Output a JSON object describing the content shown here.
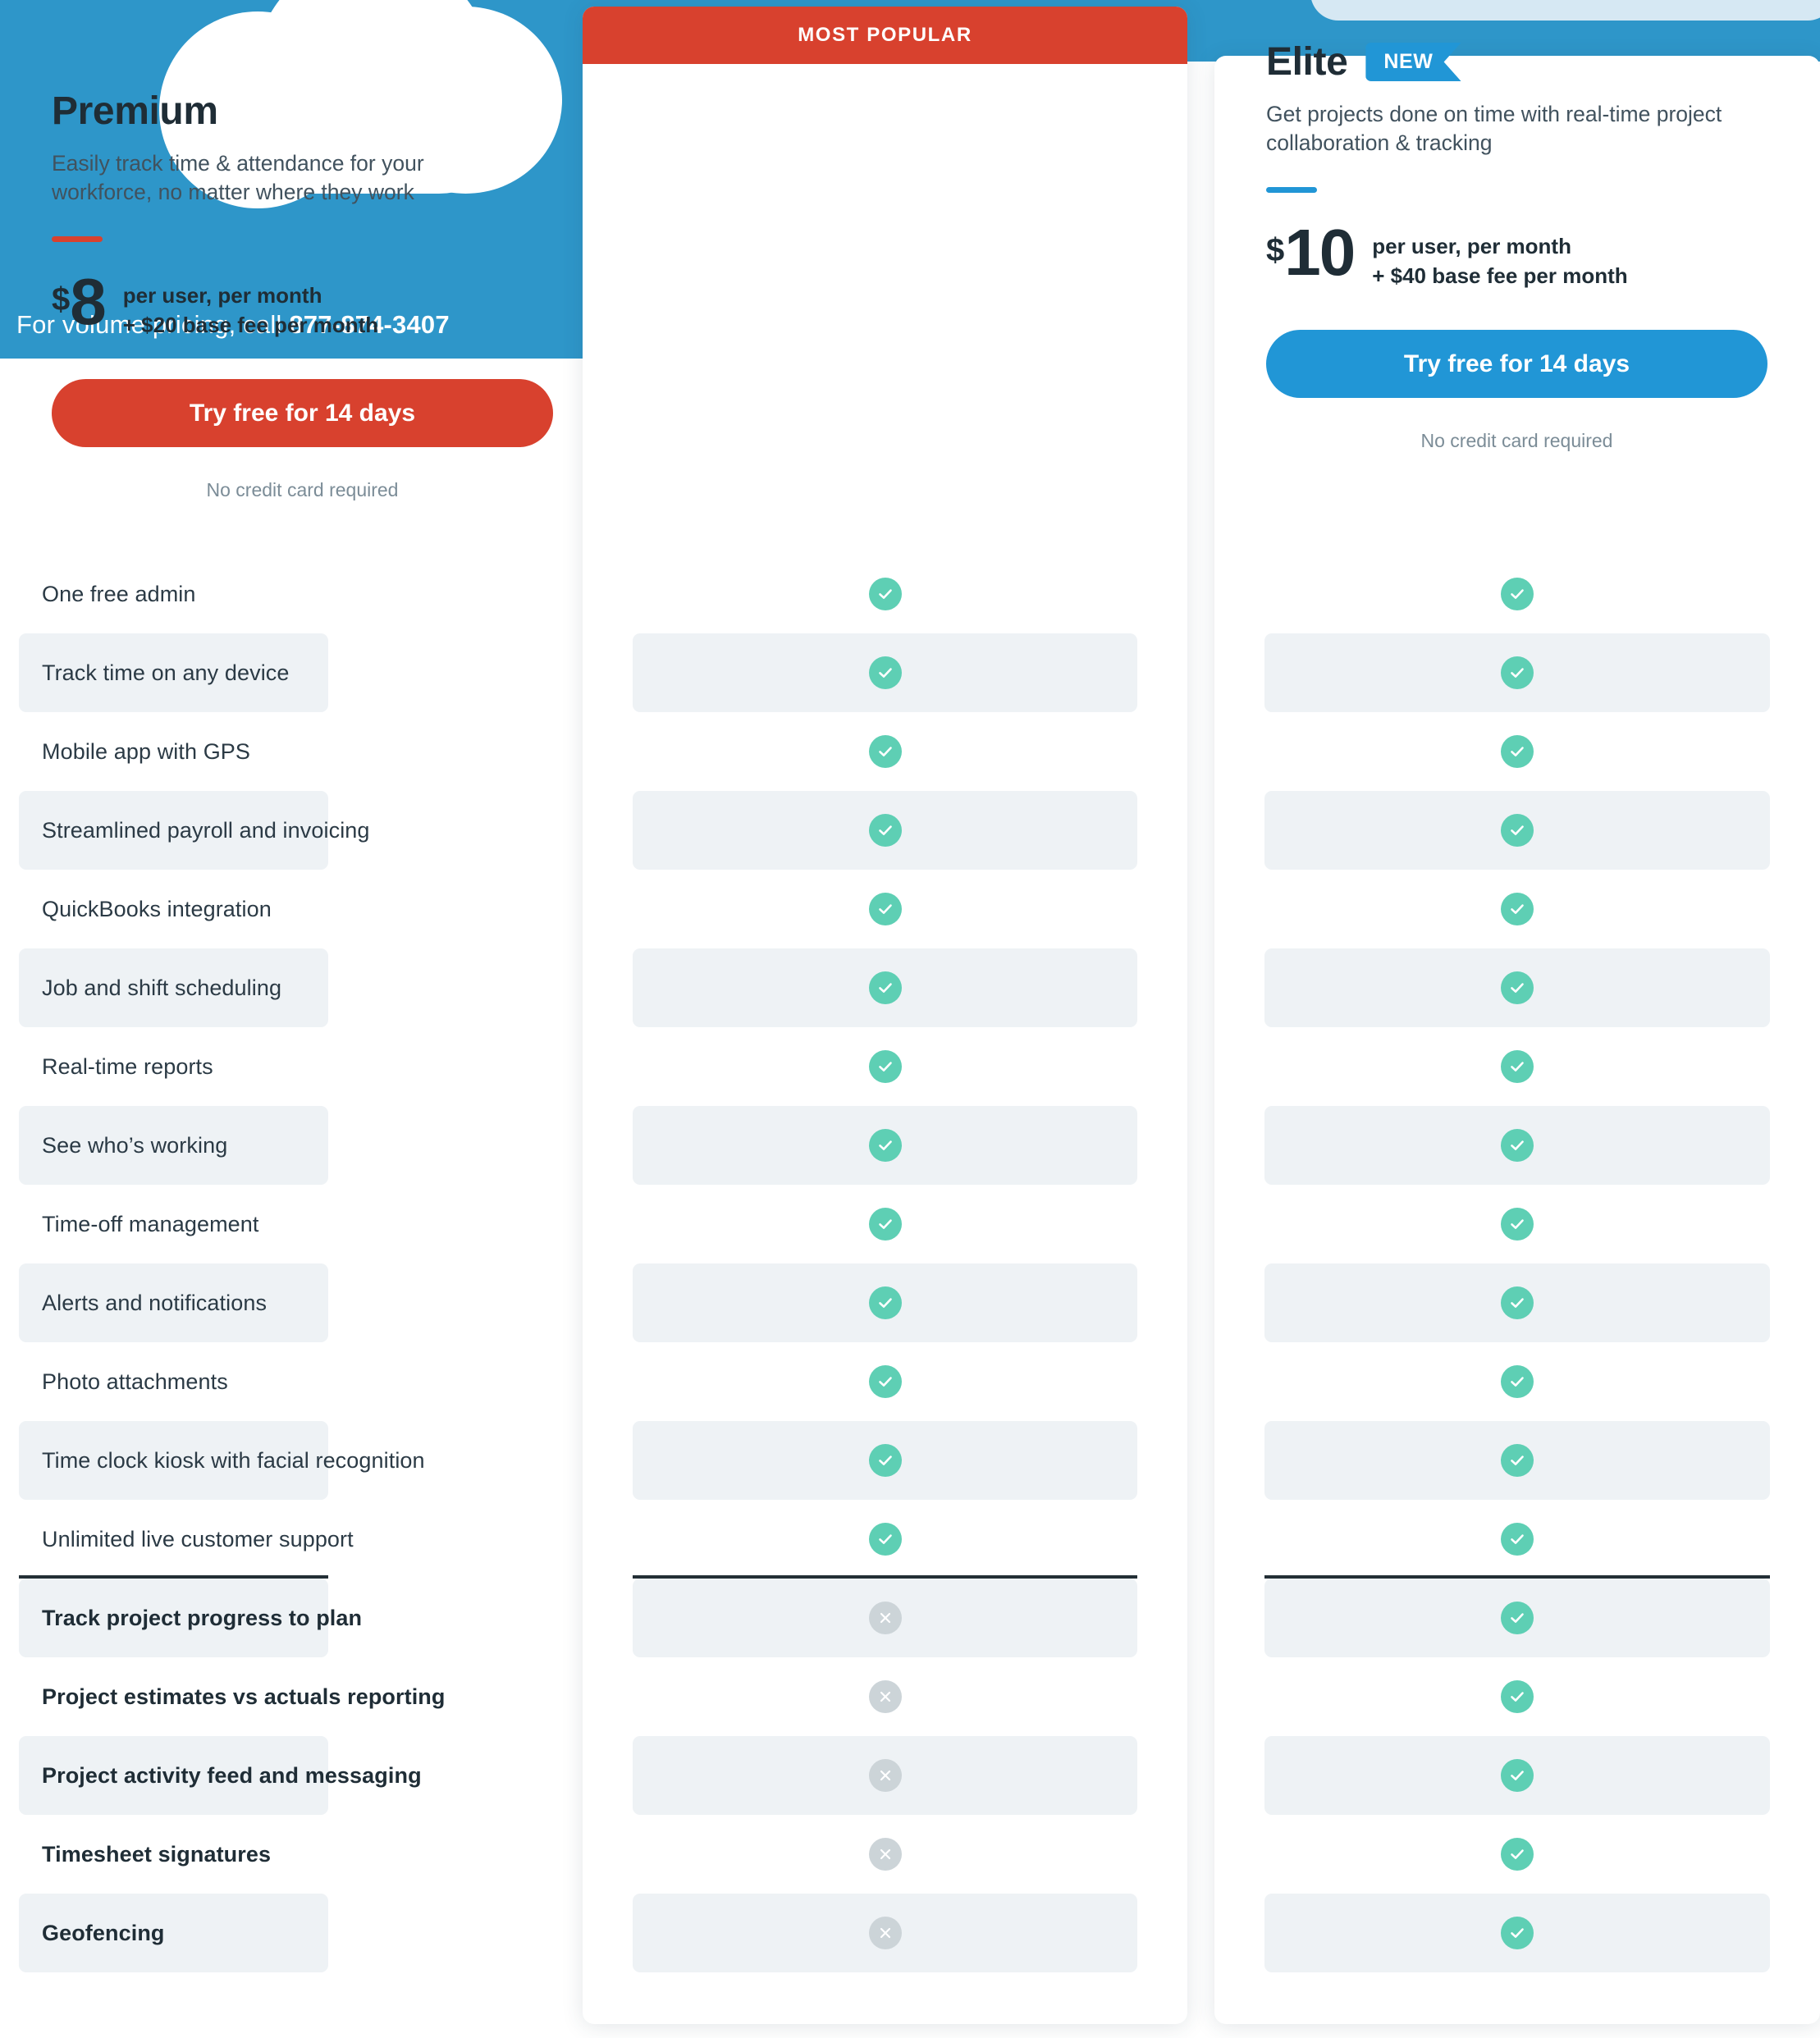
{
  "hero": {
    "phone_prefix": "For volume pricing, call ",
    "phone_number": "877-874-3407",
    "cloud_icon": "cloud-icon"
  },
  "colors": {
    "brand_blue": "#2e96c9",
    "accent_blue": "#2196d6",
    "light_blue": "#d6e8f3",
    "accent_red": "#d8412e",
    "check_green": "#5ecfb4",
    "cross_gray": "#ccd4d8",
    "row_band": "#eef2f5",
    "divider": "#232f36",
    "text_dark": "#1f2d36"
  },
  "plans": [
    {
      "id": "premium",
      "badge_banner": "MOST POPULAR",
      "name": "Premium",
      "description": "Easily track time & attendance for your workforce, no matter where they work",
      "currency": "$",
      "price": "8",
      "price_unit": "per user, per month",
      "price_base": "+ $20 base fee per month",
      "cta_label": "Try free for 14 days",
      "cta_note": "No credit card required"
    },
    {
      "id": "elite",
      "name": "Elite",
      "new_badge": "NEW",
      "description": "Get projects done on time with real-time project collaboration & tracking",
      "currency": "$",
      "price": "10",
      "price_unit": "per user, per month",
      "price_base": "+ $40 base fee per month",
      "cta_label": "Try free for 14 days",
      "cta_note": "No credit card required"
    }
  ],
  "features": [
    {
      "label": "One free admin",
      "bold": false,
      "premium": "yes",
      "elite": "yes"
    },
    {
      "label": "Track time on any device",
      "bold": false,
      "premium": "yes",
      "elite": "yes"
    },
    {
      "label": "Mobile app with GPS",
      "bold": false,
      "premium": "yes",
      "elite": "yes"
    },
    {
      "label": "Streamlined payroll and invoicing",
      "bold": false,
      "premium": "yes",
      "elite": "yes"
    },
    {
      "label": "QuickBooks integration",
      "bold": false,
      "premium": "yes",
      "elite": "yes"
    },
    {
      "label": "Job and shift scheduling",
      "bold": false,
      "premium": "yes",
      "elite": "yes"
    },
    {
      "label": "Real-time reports",
      "bold": false,
      "premium": "yes",
      "elite": "yes"
    },
    {
      "label": "See who’s working",
      "bold": false,
      "premium": "yes",
      "elite": "yes"
    },
    {
      "label": "Time-off management",
      "bold": false,
      "premium": "yes",
      "elite": "yes"
    },
    {
      "label": "Alerts and notifications",
      "bold": false,
      "premium": "yes",
      "elite": "yes"
    },
    {
      "label": "Photo attachments",
      "bold": false,
      "premium": "yes",
      "elite": "yes"
    },
    {
      "label": "Time clock kiosk with facial recognition",
      "bold": false,
      "premium": "yes",
      "elite": "yes"
    },
    {
      "label": "Unlimited live customer support",
      "bold": false,
      "premium": "yes",
      "elite": "yes"
    },
    {
      "label": "Track project progress to plan",
      "bold": true,
      "premium": "no",
      "elite": "yes"
    },
    {
      "label": "Project estimates vs actuals reporting",
      "bold": true,
      "premium": "no",
      "elite": "yes"
    },
    {
      "label": "Project activity feed and messaging",
      "bold": true,
      "premium": "no",
      "elite": "yes"
    },
    {
      "label": "Timesheet signatures",
      "bold": true,
      "premium": "no",
      "elite": "yes"
    },
    {
      "label": "Geofencing",
      "bold": true,
      "premium": "no",
      "elite": "yes"
    }
  ],
  "divider_after_index": 12
}
